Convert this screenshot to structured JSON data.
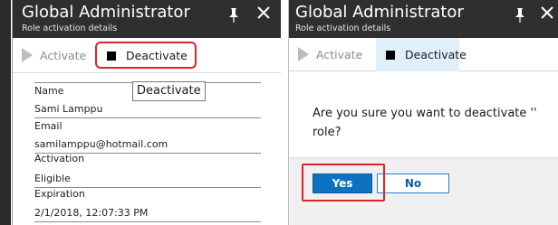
{
  "left_panel": {
    "header": {
      "title": "Global Administrator",
      "subtitle": "Role activation details"
    },
    "toolbar": {
      "activate_label": "Activate",
      "deactivate_label": "Deactivate"
    },
    "fields": [
      {
        "label": "Name",
        "value": "Sami Lamppu"
      },
      {
        "label": "Email",
        "value": "samilamppu@hotmail.com"
      },
      {
        "label": "Activation",
        "value": "Eligible"
      },
      {
        "label": "Expiration",
        "value": "2/1/2018, 12:07:33 PM"
      }
    ],
    "tooltip": "Deactivate"
  },
  "right_panel": {
    "header": {
      "title": "Global Administrator",
      "subtitle": "Role activation details"
    },
    "toolbar": {
      "activate_label": "Activate",
      "deactivate_label": "Deactivate"
    },
    "dialog": {
      "message": "Are you sure you want to deactivate '' role?",
      "yes_label": "Yes",
      "no_label": "No"
    }
  },
  "icons": {
    "pin": "pin-icon",
    "close": "close-icon",
    "play": "play-icon",
    "stop": "stop-icon"
  },
  "colors": {
    "header_bg": "#2f2f2f",
    "highlight_red": "#d9262b",
    "primary_blue": "#0e72c2",
    "selected_tab_bg": "#dff0fb",
    "dialog_footer_bg": "#f0f0f0"
  }
}
